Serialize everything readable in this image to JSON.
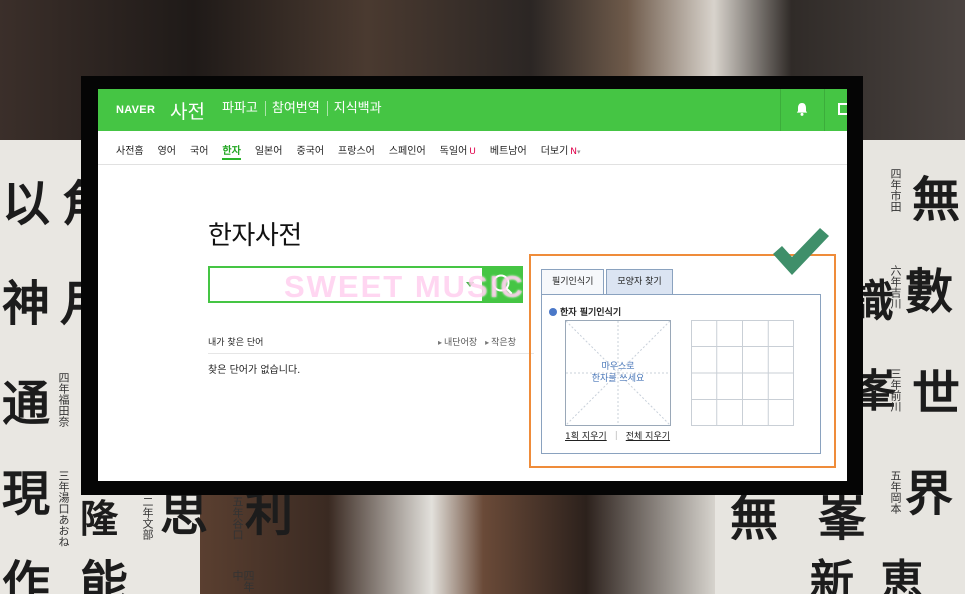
{
  "header": {
    "logo": "NAVER",
    "service": "사전",
    "links": [
      "파파고",
      "참여번역",
      "지식백과"
    ]
  },
  "nav": {
    "items": [
      {
        "label": "사전홈"
      },
      {
        "label": "영어"
      },
      {
        "label": "국어"
      },
      {
        "label": "한자",
        "active": true
      },
      {
        "label": "일본어"
      },
      {
        "label": "중국어"
      },
      {
        "label": "프랑스어"
      },
      {
        "label": "스페인어"
      },
      {
        "label": "독일어",
        "badge": "U"
      },
      {
        "label": "베트남어"
      },
      {
        "label": "더보기",
        "badge": "N"
      }
    ]
  },
  "main": {
    "title": "한자사전",
    "search_value": "",
    "watermark": "SWEET MUSIC",
    "recent_label": "내가 찾은 단어",
    "recent_links": [
      "내단어장",
      "작은창"
    ],
    "empty_message": "찾은 단어가 없습니다."
  },
  "widget": {
    "tabs": [
      "필기인식기",
      "모양자 찾기"
    ],
    "heading": "한자 필기인식기",
    "hint_line1": "마우스로",
    "hint_line2": "한자를 쓰세요",
    "erase_one": "1획 지우기",
    "erase_all": "전체 지우기"
  },
  "background": {
    "kanji": [
      "以",
      "角",
      "神",
      "月",
      "通",
      "現",
      "隆",
      "思",
      "利",
      "作",
      "能",
      "無",
      "數",
      "識",
      "峯",
      "世",
      "無",
      "峯",
      "界",
      "新",
      "恵"
    ],
    "small_kanji": [
      "四年市田",
      "六年吉川",
      "三年前川",
      "五年岡本",
      "四年福田奈",
      "三年湯口あおね",
      "五年谷口",
      "二年文部",
      "四年中"
    ]
  },
  "colors": {
    "naver_green": "#45c544",
    "highlight_orange": "#ef8c3a",
    "check_green": "#3f8f6a",
    "link_blue": "#4876b8"
  }
}
